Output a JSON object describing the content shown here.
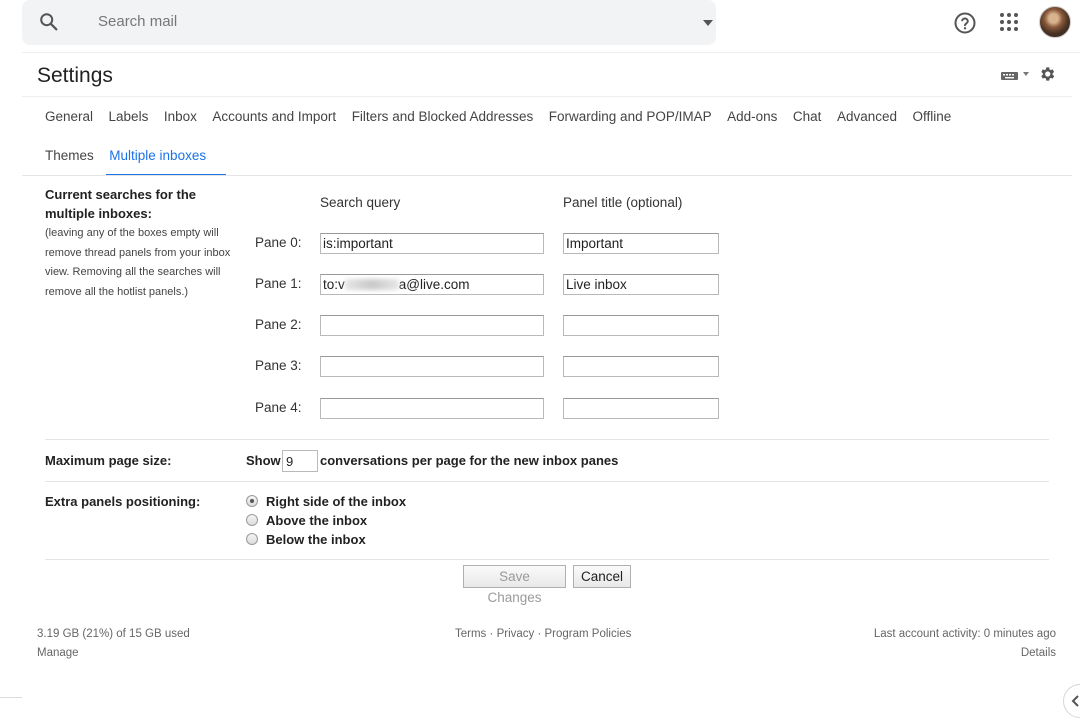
{
  "search": {
    "placeholder": "Search mail"
  },
  "header": {
    "title": "Settings"
  },
  "tabs": {
    "row1": [
      "General",
      "Labels",
      "Inbox",
      "Accounts and Import",
      "Filters and Blocked Addresses",
      "Forwarding and POP/IMAP",
      "Add-ons",
      "Chat",
      "Advanced",
      "Offline"
    ],
    "row2": [
      "Themes",
      "Multiple inboxes"
    ],
    "active": "Multiple inboxes"
  },
  "current_searches": {
    "label": "Current searches for the multiple inboxes:",
    "note": "(leaving any of the boxes empty will remove thread panels from your inbox view. Removing all the searches will remove all the hotlist panels.)",
    "query_header": "Search query",
    "title_header": "Panel title (optional)",
    "panes": [
      {
        "label": "Pane 0:",
        "query": "is:important",
        "title": "Important"
      },
      {
        "label": "Pane 1:",
        "query_prefix": "to:v",
        "query_suffix": "a@live.com",
        "title": "Live inbox"
      },
      {
        "label": "Pane 2:",
        "query": "",
        "title": ""
      },
      {
        "label": "Pane 3:",
        "query": "",
        "title": ""
      },
      {
        "label": "Pane 4:",
        "query": "",
        "title": ""
      }
    ]
  },
  "page_size": {
    "label": "Maximum page size:",
    "show": "Show",
    "value": "9",
    "suffix": "conversations per page for the new inbox panes"
  },
  "positioning": {
    "label": "Extra panels positioning:",
    "options": [
      "Right side of the inbox",
      "Above the inbox",
      "Below the inbox"
    ],
    "selected": "Right side of the inbox"
  },
  "buttons": {
    "save": "Save Changes",
    "cancel": "Cancel"
  },
  "footer": {
    "storage": "3.19 GB (21%) of 15 GB used",
    "manage": "Manage",
    "terms": "Terms",
    "privacy": "Privacy",
    "program_policies": "Program Policies",
    "separator": "·",
    "last_activity": "Last account activity: 0 minutes ago",
    "details": "Details"
  }
}
